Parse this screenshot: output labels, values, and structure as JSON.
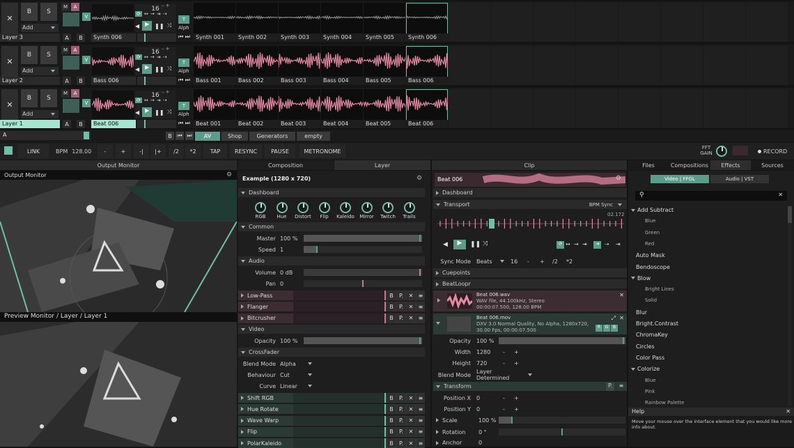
{
  "colors": {
    "accent": "#6fc0a9",
    "pink": "#e88aa6",
    "bg": "#141414"
  },
  "layers": [
    {
      "name": "Layer 3",
      "clip": "Synth 006",
      "num": "16",
      "alph": "Alph",
      "m": "M",
      "a": "A",
      "b": "B",
      "s": "S",
      "add": "Add",
      "ab_a": "A",
      "ab_b": "B",
      "t": "T",
      "v": "V",
      "clips": [
        "Synth 001",
        "Synth 002",
        "Synth 003",
        "Synth 004",
        "Synth 005",
        "Synth 006"
      ]
    },
    {
      "name": "Layer 2",
      "clip": "Bass 006",
      "num": "16",
      "alph": "Alph",
      "m": "M",
      "a": "A",
      "b": "B",
      "s": "S",
      "add": "Add",
      "ab_a": "A",
      "ab_b": "B",
      "t": "T",
      "v": "V",
      "clips": [
        "Bass 001",
        "Bass 002",
        "Bass 003",
        "Bass 004",
        "Bass 005",
        "Bass 006"
      ]
    },
    {
      "name": "Layer 1",
      "clip": "Beat 006",
      "num": "16",
      "alph": "Alph",
      "m": "M",
      "a": "A",
      "b": "B",
      "s": "S",
      "add": "Add",
      "ab_a": "A",
      "ab_b": "B",
      "t": "T",
      "v": "V",
      "clips": [
        "Beat 001",
        "Beat 002",
        "Beat 003",
        "Beat 004",
        "Beat 005",
        "Beat 006"
      ]
    }
  ],
  "deck": {
    "a": "A",
    "b": "B",
    "tabs": [
      "AV",
      "Shop",
      "Generators",
      "empty"
    ]
  },
  "transportbar": {
    "link": "LINK",
    "bpm_label": "BPM",
    "bpm": "128.00",
    "minus": "-",
    "plus": "+",
    "nudge_l": "-|",
    "nudge_r": "|+",
    "div": "/2",
    "mul": "*2",
    "tap": "TAP",
    "resync": "RESYNC",
    "pause": "PAUSE",
    "metronome": "METRONOME",
    "fft": "FFT",
    "gain": "GAIN",
    "record": "RECORD"
  },
  "output": {
    "header": "Output Monitor",
    "title": "Output Monitor",
    "preview": "Preview Monitor / Layer / Layer 1"
  },
  "composition": {
    "tab_comp": "Composition",
    "tab_layer": "Layer",
    "title": "Example (1280 x 720)",
    "dashboard": "Dashboard",
    "knobs": [
      "RGB",
      "Hue",
      "Distort",
      "Flip",
      "Kaleido",
      "Mirror",
      "Twitch",
      "Trails"
    ],
    "common": "Common",
    "master_label": "Master",
    "master": "100 %",
    "speed_label": "Speed",
    "speed": "1",
    "audio": "Audio",
    "volume_label": "Volume",
    "volume": "0 dB",
    "pan_label": "Pan",
    "pan": "0",
    "audio_fx": [
      "Low-Pass",
      "Flanger",
      "Bitcrusher"
    ],
    "video": "Video",
    "opacity_label": "Opacity",
    "opacity": "100 %",
    "crossfader": "CrossFader",
    "blend_label": "Blend Mode",
    "blend": "Alpha",
    "behaviour_label": "Behaviour",
    "behaviour": "Cut",
    "curve_label": "Curve",
    "curve": "Linear",
    "video_fx": [
      "Shift RGB",
      "Hue Rotate",
      "Wave Warp",
      "Flip",
      "PolarKaleido"
    ],
    "fx_b": "B",
    "fx_p": "P.",
    "fx_x": "✕",
    "fx_m": "≡"
  },
  "clip": {
    "header": "Clip",
    "name": "Beat 006",
    "dashboard": "Dashboard",
    "transport": "Transport",
    "bpm_sync": "BPM Sync",
    "time": "02.172",
    "sync_label": "Sync Mode",
    "sync": "Beats",
    "beats": "16",
    "minus": "-",
    "plus": "+",
    "div": "/2",
    "mul": "*2",
    "cuepoints": "Cuepoints",
    "beatloopr": "BeatLoopr",
    "audio_file": "Beat 006.wav",
    "audio_l1": "WAV file, 44.100kHz, Stereo",
    "audio_l2": "00:00:07.500, 128.00 BPM",
    "video_file": "Beat 006.mov",
    "video_l1": "DXV 3.0 Normal Quality, No Alpha, 1280x720,",
    "video_l2": "30.00 Fps, 00:00:07.500",
    "r": "R",
    "g": "G",
    "b": "B",
    "opacity_label": "Opacity",
    "opacity": "100 %",
    "width_label": "Width",
    "width": "1280",
    "height_label": "Height",
    "height": "720",
    "blend_label": "Blend Mode",
    "blend": "Layer Determined",
    "transform": "Transform",
    "posx_label": "Position X",
    "posx": "0",
    "posy_label": "Position Y",
    "posy": "0",
    "scale_label": "Scale",
    "scale": "100 %",
    "rotation_label": "Rotation",
    "rotation": "0 °",
    "anchor_label": "Anchor",
    "anchor": "0"
  },
  "browser": {
    "tabs": [
      "Files",
      "Compositions",
      "Effects",
      "Sources"
    ],
    "sub_video": "Video | FFGL",
    "sub_audio": "Audio | VST",
    "items": [
      {
        "label": "Add Subtract",
        "group": true,
        "open": true
      },
      {
        "label": "Blue",
        "sub": true
      },
      {
        "label": "Green",
        "sub": true
      },
      {
        "label": "Red",
        "sub": true
      },
      {
        "label": "Auto Mask"
      },
      {
        "label": "Bendoscope"
      },
      {
        "label": "Blow",
        "group": true,
        "open": true
      },
      {
        "label": "Bright Lines",
        "sub": true
      },
      {
        "label": "Solid",
        "sub": true
      },
      {
        "label": "Blur"
      },
      {
        "label": "Bright.Contrast"
      },
      {
        "label": "ChromaKey"
      },
      {
        "label": "Circles"
      },
      {
        "label": "Color Pass"
      },
      {
        "label": "Colorize",
        "group": true,
        "open": true
      },
      {
        "label": "Blue",
        "sub": true
      },
      {
        "label": "Pink",
        "sub": true
      },
      {
        "label": "Rainbow Palette",
        "sub": true
      }
    ],
    "help_title": "Help",
    "help_text": "Move your mouse over the interface element that you would like more info about."
  }
}
